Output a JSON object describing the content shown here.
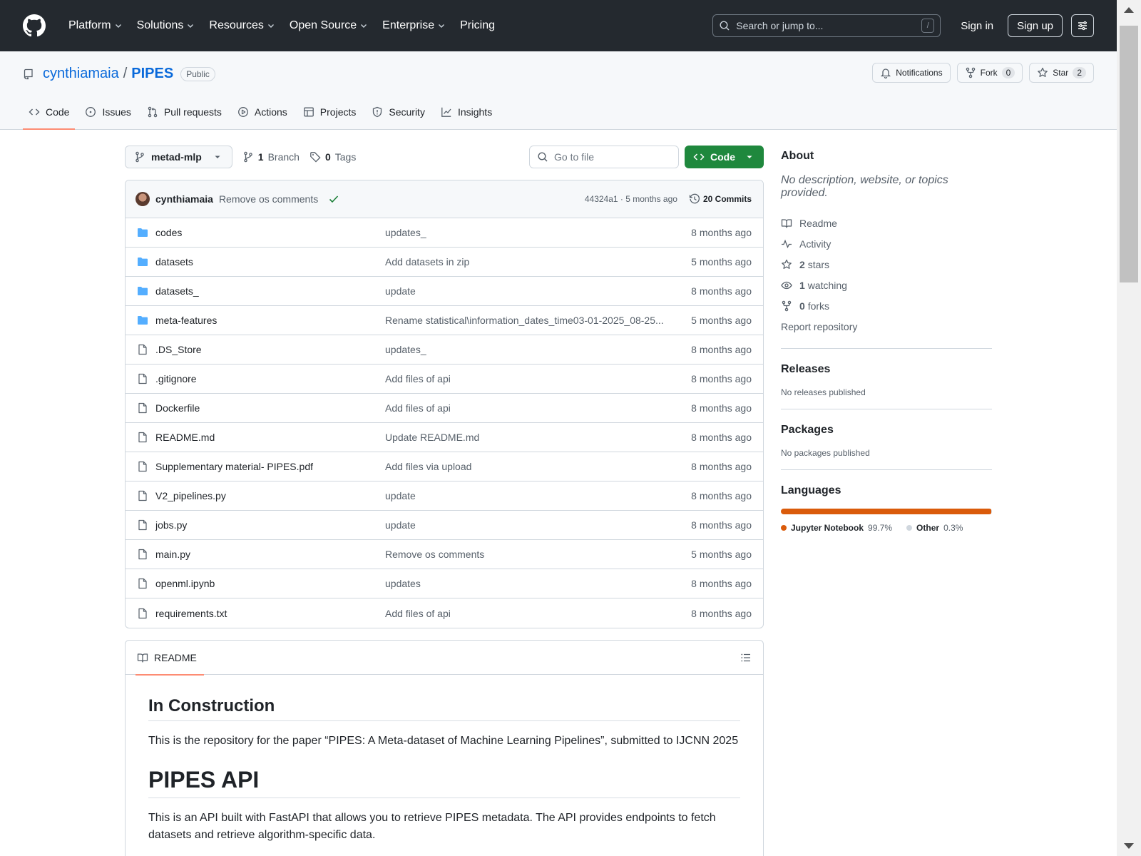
{
  "colors": {
    "header_bg": "#24292f",
    "link": "#0969da",
    "code_button": "#1f883d",
    "tab_underline": "#fd8c73",
    "folder": "#54aeff"
  },
  "topnav": {
    "items": [
      "Platform",
      "Solutions",
      "Resources",
      "Open Source",
      "Enterprise",
      "Pricing"
    ],
    "search_placeholder": "Search or jump to...",
    "search_shortcut": "/",
    "signin": "Sign in",
    "signup": "Sign up"
  },
  "repo": {
    "owner": "cynthiamaia",
    "separator": "/",
    "name": "PIPES",
    "visibility": "Public",
    "notifications": "Notifications",
    "fork_label": "Fork",
    "fork_count": "0",
    "star_label": "Star",
    "star_count": "2"
  },
  "tabs": [
    "Code",
    "Issues",
    "Pull requests",
    "Actions",
    "Projects",
    "Security",
    "Insights"
  ],
  "filebar": {
    "branch": "metad-mlp",
    "branch_count": "1",
    "branch_label": "Branch",
    "tag_count": "0",
    "tag_label": "Tags",
    "goto_placeholder": "Go to file",
    "code_label": "Code"
  },
  "commit": {
    "author": "cynthiamaia",
    "message": "Remove os comments",
    "meta": "44324a1 · 5 months ago",
    "commits_label": "20 Commits"
  },
  "files": [
    {
      "type": "dir",
      "name": "codes",
      "message": "updates_",
      "age": "8 months ago"
    },
    {
      "type": "dir",
      "name": "datasets",
      "message": "Add datasets in zip",
      "age": "5 months ago"
    },
    {
      "type": "dir",
      "name": "datasets_",
      "message": "update",
      "age": "8 months ago"
    },
    {
      "type": "dir",
      "name": "meta-features",
      "message": "Rename statistical\\information_dates_time03-01-2025_08-25...",
      "age": "5 months ago"
    },
    {
      "type": "file",
      "name": ".DS_Store",
      "message": "updates_",
      "age": "8 months ago"
    },
    {
      "type": "file",
      "name": ".gitignore",
      "message": "Add files of api",
      "age": "8 months ago"
    },
    {
      "type": "file",
      "name": "Dockerfile",
      "message": "Add files of api",
      "age": "8 months ago"
    },
    {
      "type": "file",
      "name": "README.md",
      "message": "Update README.md",
      "age": "8 months ago"
    },
    {
      "type": "file",
      "name": "Supplementary material- PIPES.pdf",
      "message": "Add files via upload",
      "age": "8 months ago"
    },
    {
      "type": "file",
      "name": "V2_pipelines.py",
      "message": "update",
      "age": "8 months ago"
    },
    {
      "type": "file",
      "name": "jobs.py",
      "message": "update",
      "age": "8 months ago"
    },
    {
      "type": "file",
      "name": "main.py",
      "message": "Remove os comments",
      "age": "5 months ago"
    },
    {
      "type": "file",
      "name": "openml.ipynb",
      "message": "updates",
      "age": "8 months ago"
    },
    {
      "type": "file",
      "name": "requirements.txt",
      "message": "Add files of api",
      "age": "8 months ago"
    }
  ],
  "readme": {
    "tab_label": "README",
    "h2": "In Construction",
    "p1": "This is the repository for the paper “PIPES: A Meta-dataset of Machine Learning Pipelines”, submitted to IJCNN 2025",
    "h1": "PIPES API",
    "p2": "This is an API built with FastAPI that allows you to retrieve PIPES metadata. The API provides endpoints to fetch datasets and retrieve algorithm-specific data."
  },
  "about": {
    "title": "About",
    "description": "No description, website, or topics provided.",
    "readme": "Readme",
    "activity": "Activity",
    "stars_count": "2",
    "stars_label": "stars",
    "watching_count": "1",
    "watching_label": "watching",
    "forks_count": "0",
    "forks_label": "forks",
    "report": "Report repository"
  },
  "releases": {
    "title": "Releases",
    "empty": "No releases published"
  },
  "packages": {
    "title": "Packages",
    "empty": "No packages published"
  },
  "languages": {
    "title": "Languages",
    "items": [
      {
        "name": "Jupyter Notebook",
        "percent": "99.7%",
        "value": 99.7,
        "color": "#DA5B0B"
      },
      {
        "name": "Other",
        "percent": "0.3%",
        "value": 0.3,
        "color": "#d0d7de"
      }
    ]
  }
}
